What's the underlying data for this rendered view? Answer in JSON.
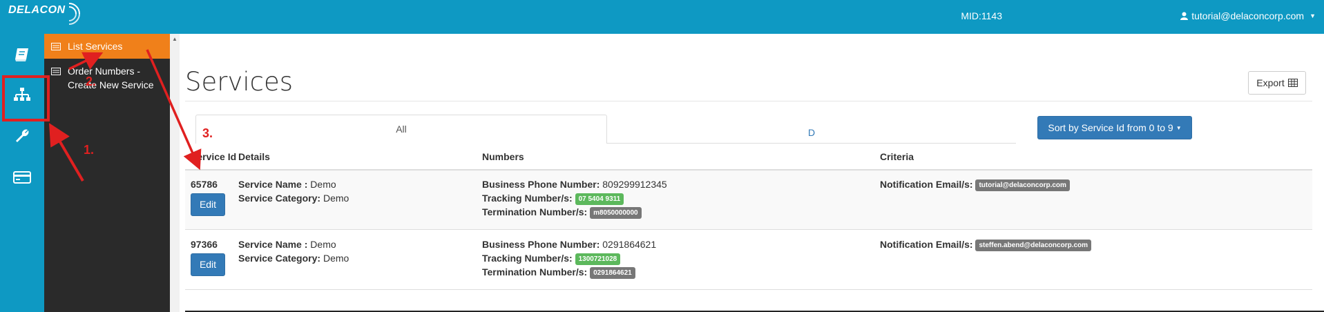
{
  "header": {
    "logo_text": "DELACON",
    "mid": "MID:1143",
    "user": "tutorial@delaconcorp.com"
  },
  "rail": {
    "icons": [
      "book-icon",
      "sitemap-icon",
      "wrench-icon",
      "credit-card-icon"
    ]
  },
  "submenu": {
    "items": [
      {
        "label": "List Services",
        "active": true
      },
      {
        "label": "Order Numbers - Create New Service",
        "active": false
      }
    ]
  },
  "main": {
    "title": "Services",
    "export_label": "Export",
    "tabs": [
      {
        "label": "All",
        "active": true
      },
      {
        "label": "D",
        "active": false
      }
    ],
    "sort_label": "Sort by Service Id from 0 to 9",
    "table": {
      "headers": [
        "Service Id",
        "Details",
        "Numbers",
        "Criteria"
      ],
      "rows": [
        {
          "service_id": "65786",
          "edit_label": "Edit",
          "service_name_label": "Service Name :",
          "service_name": "Demo",
          "service_category_label": "Service Category:",
          "service_category": "Demo",
          "business_phone_label": "Business Phone Number:",
          "business_phone": "809299912345",
          "tracking_label": "Tracking Number/s:",
          "tracking": "07 5404 9311",
          "termination_label": "Termination Number/s:",
          "termination": "m8050000000",
          "notification_label": "Notification Email/s:",
          "notification": "tutorial@delaconcorp.com"
        },
        {
          "service_id": "97366",
          "edit_label": "Edit",
          "service_name_label": "Service Name :",
          "service_name": "Demo",
          "service_category_label": "Service Category:",
          "service_category": "Demo",
          "business_phone_label": "Business Phone Number:",
          "business_phone": "0291864621",
          "tracking_label": "Tracking Number/s:",
          "tracking": "1300721028",
          "termination_label": "Termination Number/s:",
          "termination": "0291864621",
          "notification_label": "Notification Email/s:",
          "notification": "steffen.abend@delaconcorp.com"
        }
      ]
    }
  },
  "annotations": {
    "step1": "1.",
    "step2": "2.",
    "step3": "3."
  },
  "colors": {
    "brand": "#0e99c3",
    "active_menu": "#f0801a",
    "primary_button": "#337ab7",
    "annotation": "#e02020",
    "badge_green": "#5cb85c",
    "badge_gray": "#777777"
  }
}
